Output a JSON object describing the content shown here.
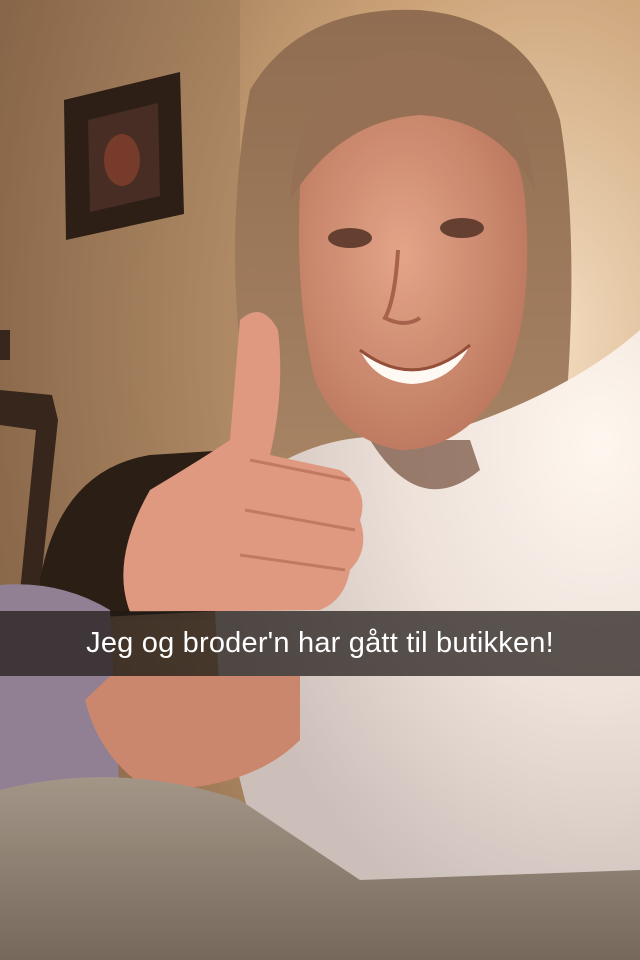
{
  "photo": {
    "subject": "selfie-thumbs-up",
    "wall_color": "#c9a57f",
    "shirt_color": "#f4efe9"
  },
  "caption": {
    "text": "Jeg og broder'n har gått til butikken!"
  }
}
